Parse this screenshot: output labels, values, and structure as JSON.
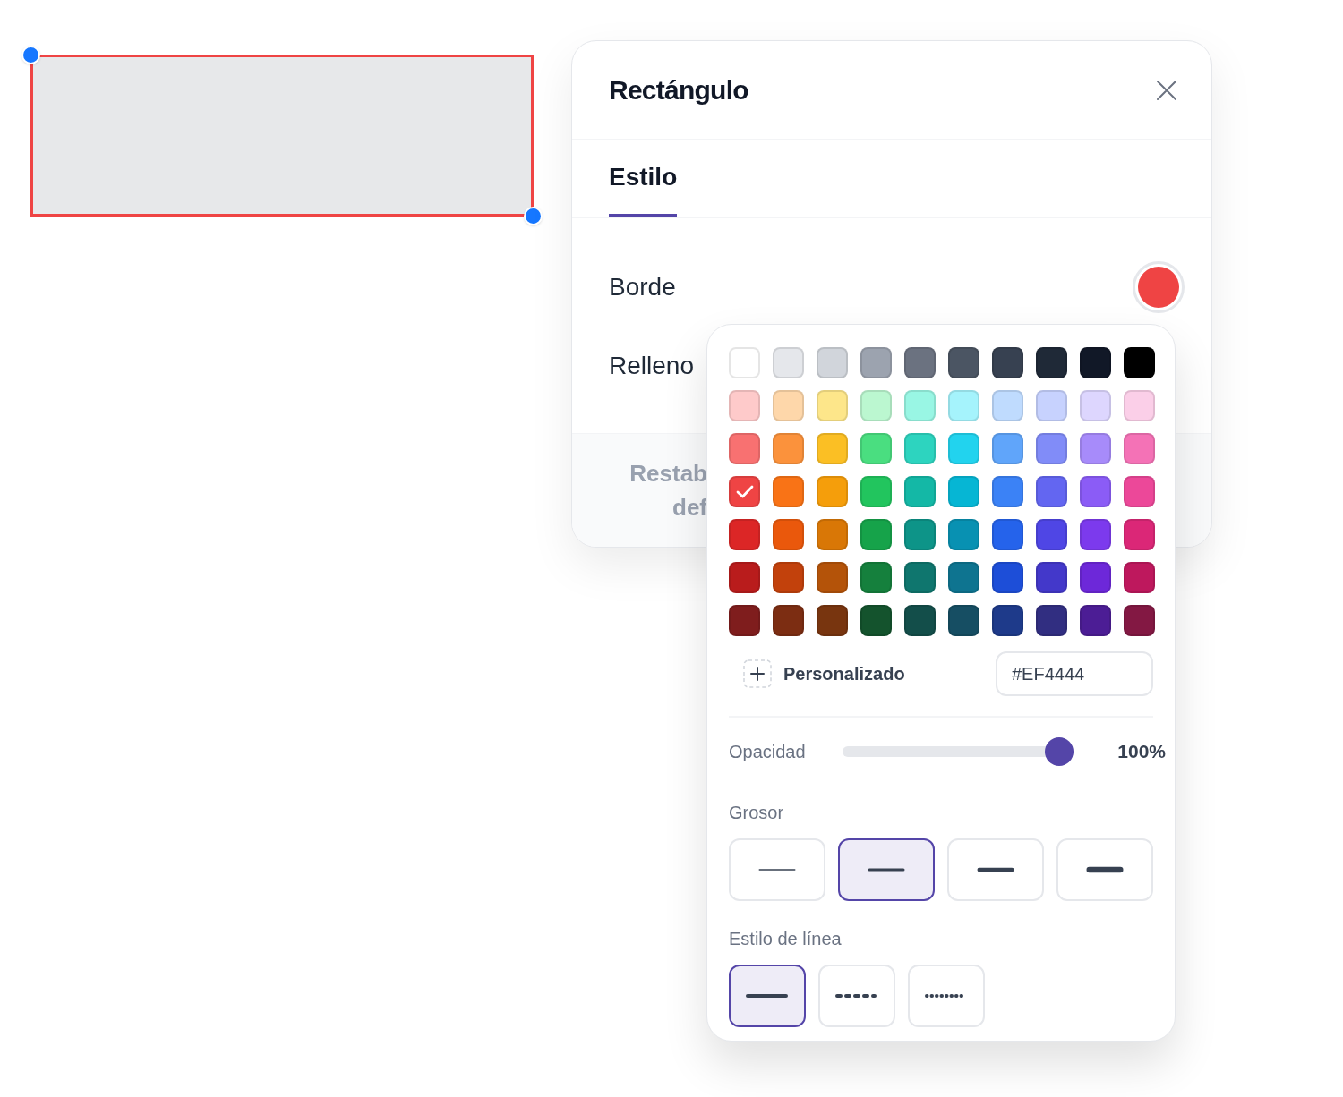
{
  "canvas": {
    "shape": {
      "kind": "rectangle",
      "selected": true
    }
  },
  "panel": {
    "title": "Rectángulo",
    "tabs": [
      {
        "label": "Estilo",
        "selected": true
      }
    ],
    "properties": [
      {
        "label": "Borde",
        "color": "#ef4444"
      },
      {
        "label": "Relleno"
      }
    ],
    "footer_button": [
      "Restab",
      "def"
    ]
  },
  "popover": {
    "swatch_rows": [
      [
        {
          "color": "#ffffff",
          "selected": false
        },
        {
          "color": "#e5e7eb",
          "selected": false
        },
        {
          "color": "#d1d5db",
          "selected": false
        },
        {
          "color": "#9ca3af",
          "selected": false
        },
        {
          "color": "#6b7280",
          "selected": false
        },
        {
          "color": "#4b5563",
          "selected": false
        },
        {
          "color": "#374151",
          "selected": false
        },
        {
          "color": "#1f2937",
          "selected": false
        },
        {
          "color": "#111827",
          "selected": false
        },
        {
          "color": "#000000",
          "selected": false
        }
      ],
      [
        {
          "color": "#fecaca",
          "selected": false
        },
        {
          "color": "#fed7aa",
          "selected": false
        },
        {
          "color": "#fde68a",
          "selected": false
        },
        {
          "color": "#bbf7d0",
          "selected": false
        },
        {
          "color": "#99f6e4",
          "selected": false
        },
        {
          "color": "#a5f3fc",
          "selected": false
        },
        {
          "color": "#bfdbfe",
          "selected": false
        },
        {
          "color": "#c7d2fe",
          "selected": false
        },
        {
          "color": "#ddd6fe",
          "selected": false
        },
        {
          "color": "#fbcfe8",
          "selected": false
        }
      ],
      [
        {
          "color": "#f87171",
          "selected": false
        },
        {
          "color": "#fb923c",
          "selected": false
        },
        {
          "color": "#fbbf24",
          "selected": false
        },
        {
          "color": "#4ade80",
          "selected": false
        },
        {
          "color": "#2dd4bf",
          "selected": false
        },
        {
          "color": "#22d3ee",
          "selected": false
        },
        {
          "color": "#60a5fa",
          "selected": false
        },
        {
          "color": "#818cf8",
          "selected": false
        },
        {
          "color": "#a78bfa",
          "selected": false
        },
        {
          "color": "#f472b6",
          "selected": false
        }
      ],
      [
        {
          "color": "#ef4444",
          "selected": true
        },
        {
          "color": "#f97316",
          "selected": false
        },
        {
          "color": "#f59e0b",
          "selected": false
        },
        {
          "color": "#22c55e",
          "selected": false
        },
        {
          "color": "#14b8a6",
          "selected": false
        },
        {
          "color": "#06b6d4",
          "selected": false
        },
        {
          "color": "#3b82f6",
          "selected": false
        },
        {
          "color": "#6366f1",
          "selected": false
        },
        {
          "color": "#8b5cf6",
          "selected": false
        },
        {
          "color": "#ec4899",
          "selected": false
        }
      ],
      [
        {
          "color": "#dc2626",
          "selected": false
        },
        {
          "color": "#ea580c",
          "selected": false
        },
        {
          "color": "#d97706",
          "selected": false
        },
        {
          "color": "#16a34a",
          "selected": false
        },
        {
          "color": "#0d9488",
          "selected": false
        },
        {
          "color": "#0891b2",
          "selected": false
        },
        {
          "color": "#2563eb",
          "selected": false
        },
        {
          "color": "#4f46e5",
          "selected": false
        },
        {
          "color": "#7c3aed",
          "selected": false
        },
        {
          "color": "#db2777",
          "selected": false
        }
      ],
      [
        {
          "color": "#b91c1c",
          "selected": false
        },
        {
          "color": "#c2410c",
          "selected": false
        },
        {
          "color": "#b45309",
          "selected": false
        },
        {
          "color": "#15803d",
          "selected": false
        },
        {
          "color": "#0f766e",
          "selected": false
        },
        {
          "color": "#0e7490",
          "selected": false
        },
        {
          "color": "#1d4ed8",
          "selected": false
        },
        {
          "color": "#4338ca",
          "selected": false
        },
        {
          "color": "#6d28d9",
          "selected": false
        },
        {
          "color": "#be185d",
          "selected": false
        }
      ],
      [
        {
          "color": "#7f1d1d",
          "selected": false
        },
        {
          "color": "#7c2d12",
          "selected": false
        },
        {
          "color": "#78350f",
          "selected": false
        },
        {
          "color": "#14532d",
          "selected": false
        },
        {
          "color": "#134e4a",
          "selected": false
        },
        {
          "color": "#164e63",
          "selected": false
        },
        {
          "color": "#1e3a8a",
          "selected": false
        },
        {
          "color": "#312e81",
          "selected": false
        },
        {
          "color": "#4c1d95",
          "selected": false
        },
        {
          "color": "#831843",
          "selected": false
        }
      ]
    ],
    "custom": {
      "label": "Personalizado",
      "value": "#EF4444"
    },
    "opacity": {
      "label": "Opacidad",
      "level": 1,
      "reading": "100%"
    },
    "thickness": {
      "label": "Grosor",
      "options": [
        {
          "kind": "thin",
          "selected": false
        },
        {
          "kind": "medium",
          "selected": true
        },
        {
          "kind": "thick",
          "selected": false
        },
        {
          "kind": "heavy",
          "selected": false
        }
      ]
    },
    "line_style": {
      "label": "Estilo de línea",
      "options": [
        {
          "kind": "solid",
          "selected": true
        },
        {
          "kind": "dashed",
          "selected": false
        },
        {
          "kind": "dotted",
          "selected": false
        }
      ]
    }
  }
}
